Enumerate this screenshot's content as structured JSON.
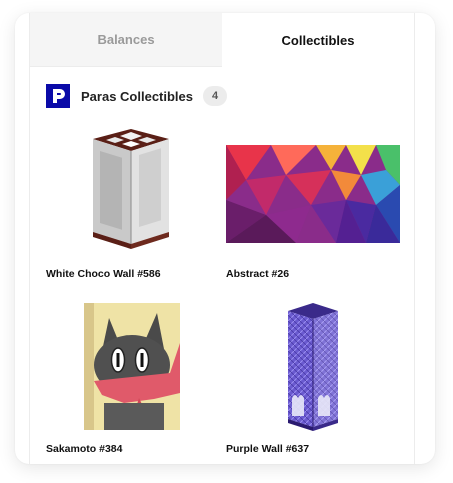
{
  "tabs": {
    "balances": "Balances",
    "collectibles": "Collectibles"
  },
  "section": {
    "title": "Paras Collectibles",
    "count": "4"
  },
  "items": [
    {
      "name": "White Choco Wall #586"
    },
    {
      "name": "Abstract #26"
    },
    {
      "name": "Sakamoto #384"
    },
    {
      "name": "Purple Wall #637"
    }
  ]
}
